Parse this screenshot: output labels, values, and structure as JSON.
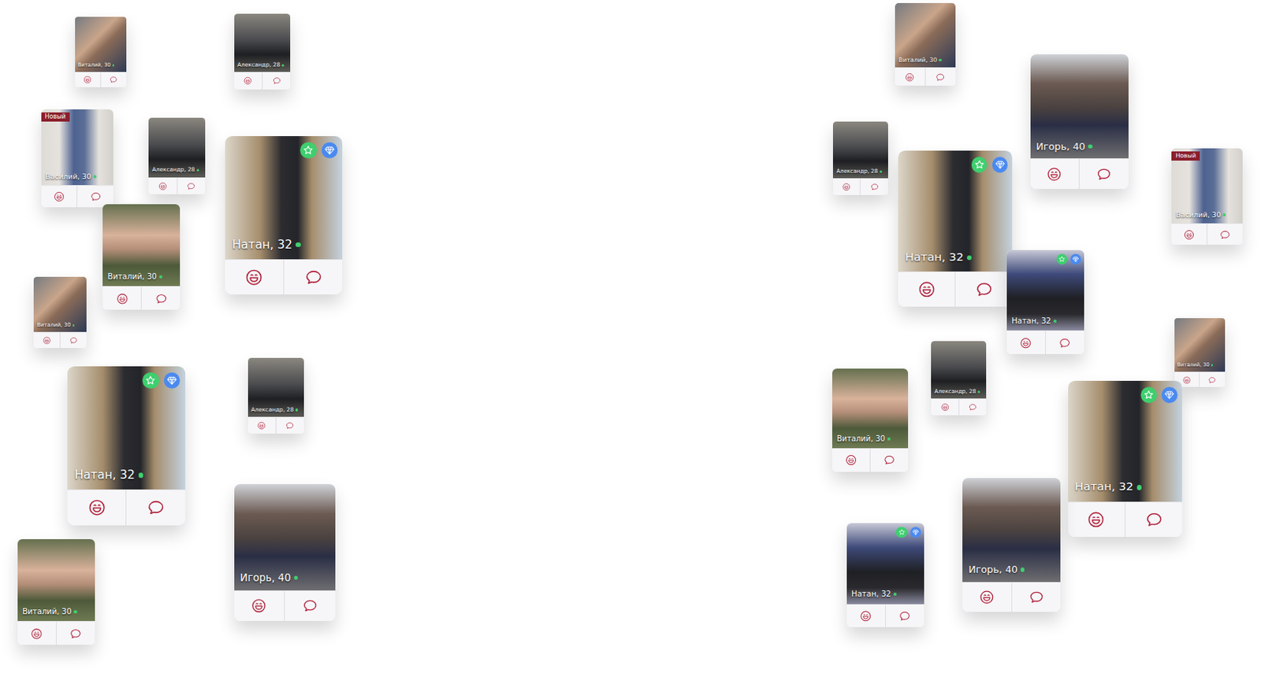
{
  "cards": [
    {
      "name": "Виталий, 30",
      "kind": "portrait",
      "online": true,
      "star": false,
      "diamond": false
    },
    {
      "name": "Александр, 28",
      "kind": "car",
      "online": true,
      "star": false,
      "diamond": false
    },
    {
      "name": "Василий, 30",
      "kind": "blazer",
      "online": true,
      "star": false,
      "diamond": false,
      "badge": "Новый"
    },
    {
      "name": "Александр, 28",
      "kind": "car",
      "online": true,
      "star": false,
      "diamond": false
    },
    {
      "name": "Натан, 32",
      "kind": "shop",
      "online": true,
      "star": true,
      "diamond": true
    },
    {
      "name": "Виталий, 30",
      "kind": "camo",
      "online": true,
      "star": false,
      "diamond": false
    },
    {
      "name": "Виталий, 30",
      "kind": "portrait",
      "online": true,
      "star": false,
      "diamond": false
    },
    {
      "name": "Натан, 32",
      "kind": "shop",
      "online": true,
      "star": true,
      "diamond": true
    },
    {
      "name": "Александр, 28",
      "kind": "car",
      "online": true,
      "star": false,
      "diamond": false
    },
    {
      "name": "Игорь, 40",
      "kind": "church",
      "online": true,
      "star": false,
      "diamond": false
    },
    {
      "name": "Виталий, 30",
      "kind": "camo",
      "online": true,
      "star": false,
      "diamond": false
    },
    {
      "name": "Виталий, 30",
      "kind": "portrait",
      "online": true,
      "star": false,
      "diamond": false
    },
    {
      "name": "Игорь, 40",
      "kind": "church",
      "online": true,
      "star": false,
      "diamond": false
    },
    {
      "name": "Александр, 28",
      "kind": "car",
      "online": true,
      "star": false,
      "diamond": false
    },
    {
      "name": "Натан, 32",
      "kind": "shop",
      "online": true,
      "star": true,
      "diamond": true
    },
    {
      "name": "Василий, 30",
      "kind": "blazer",
      "online": true,
      "star": false,
      "diamond": false,
      "badge": "Новый"
    },
    {
      "name": "Натан, 32",
      "kind": "hall",
      "online": true,
      "star": true,
      "diamond": true
    },
    {
      "name": "Виталий, 30",
      "kind": "portrait",
      "online": true,
      "star": false,
      "diamond": false
    },
    {
      "name": "Александр, 28",
      "kind": "car",
      "online": true,
      "star": false,
      "diamond": false
    },
    {
      "name": "Виталий, 30",
      "kind": "camo",
      "online": true,
      "star": false,
      "diamond": false
    },
    {
      "name": "Натан, 32",
      "kind": "shop",
      "online": true,
      "star": true,
      "diamond": true
    },
    {
      "name": "Игорь, 40",
      "kind": "church",
      "online": true,
      "star": false,
      "diamond": false
    },
    {
      "name": "Натан, 32",
      "kind": "hall",
      "online": true,
      "star": true,
      "diamond": true
    }
  ]
}
